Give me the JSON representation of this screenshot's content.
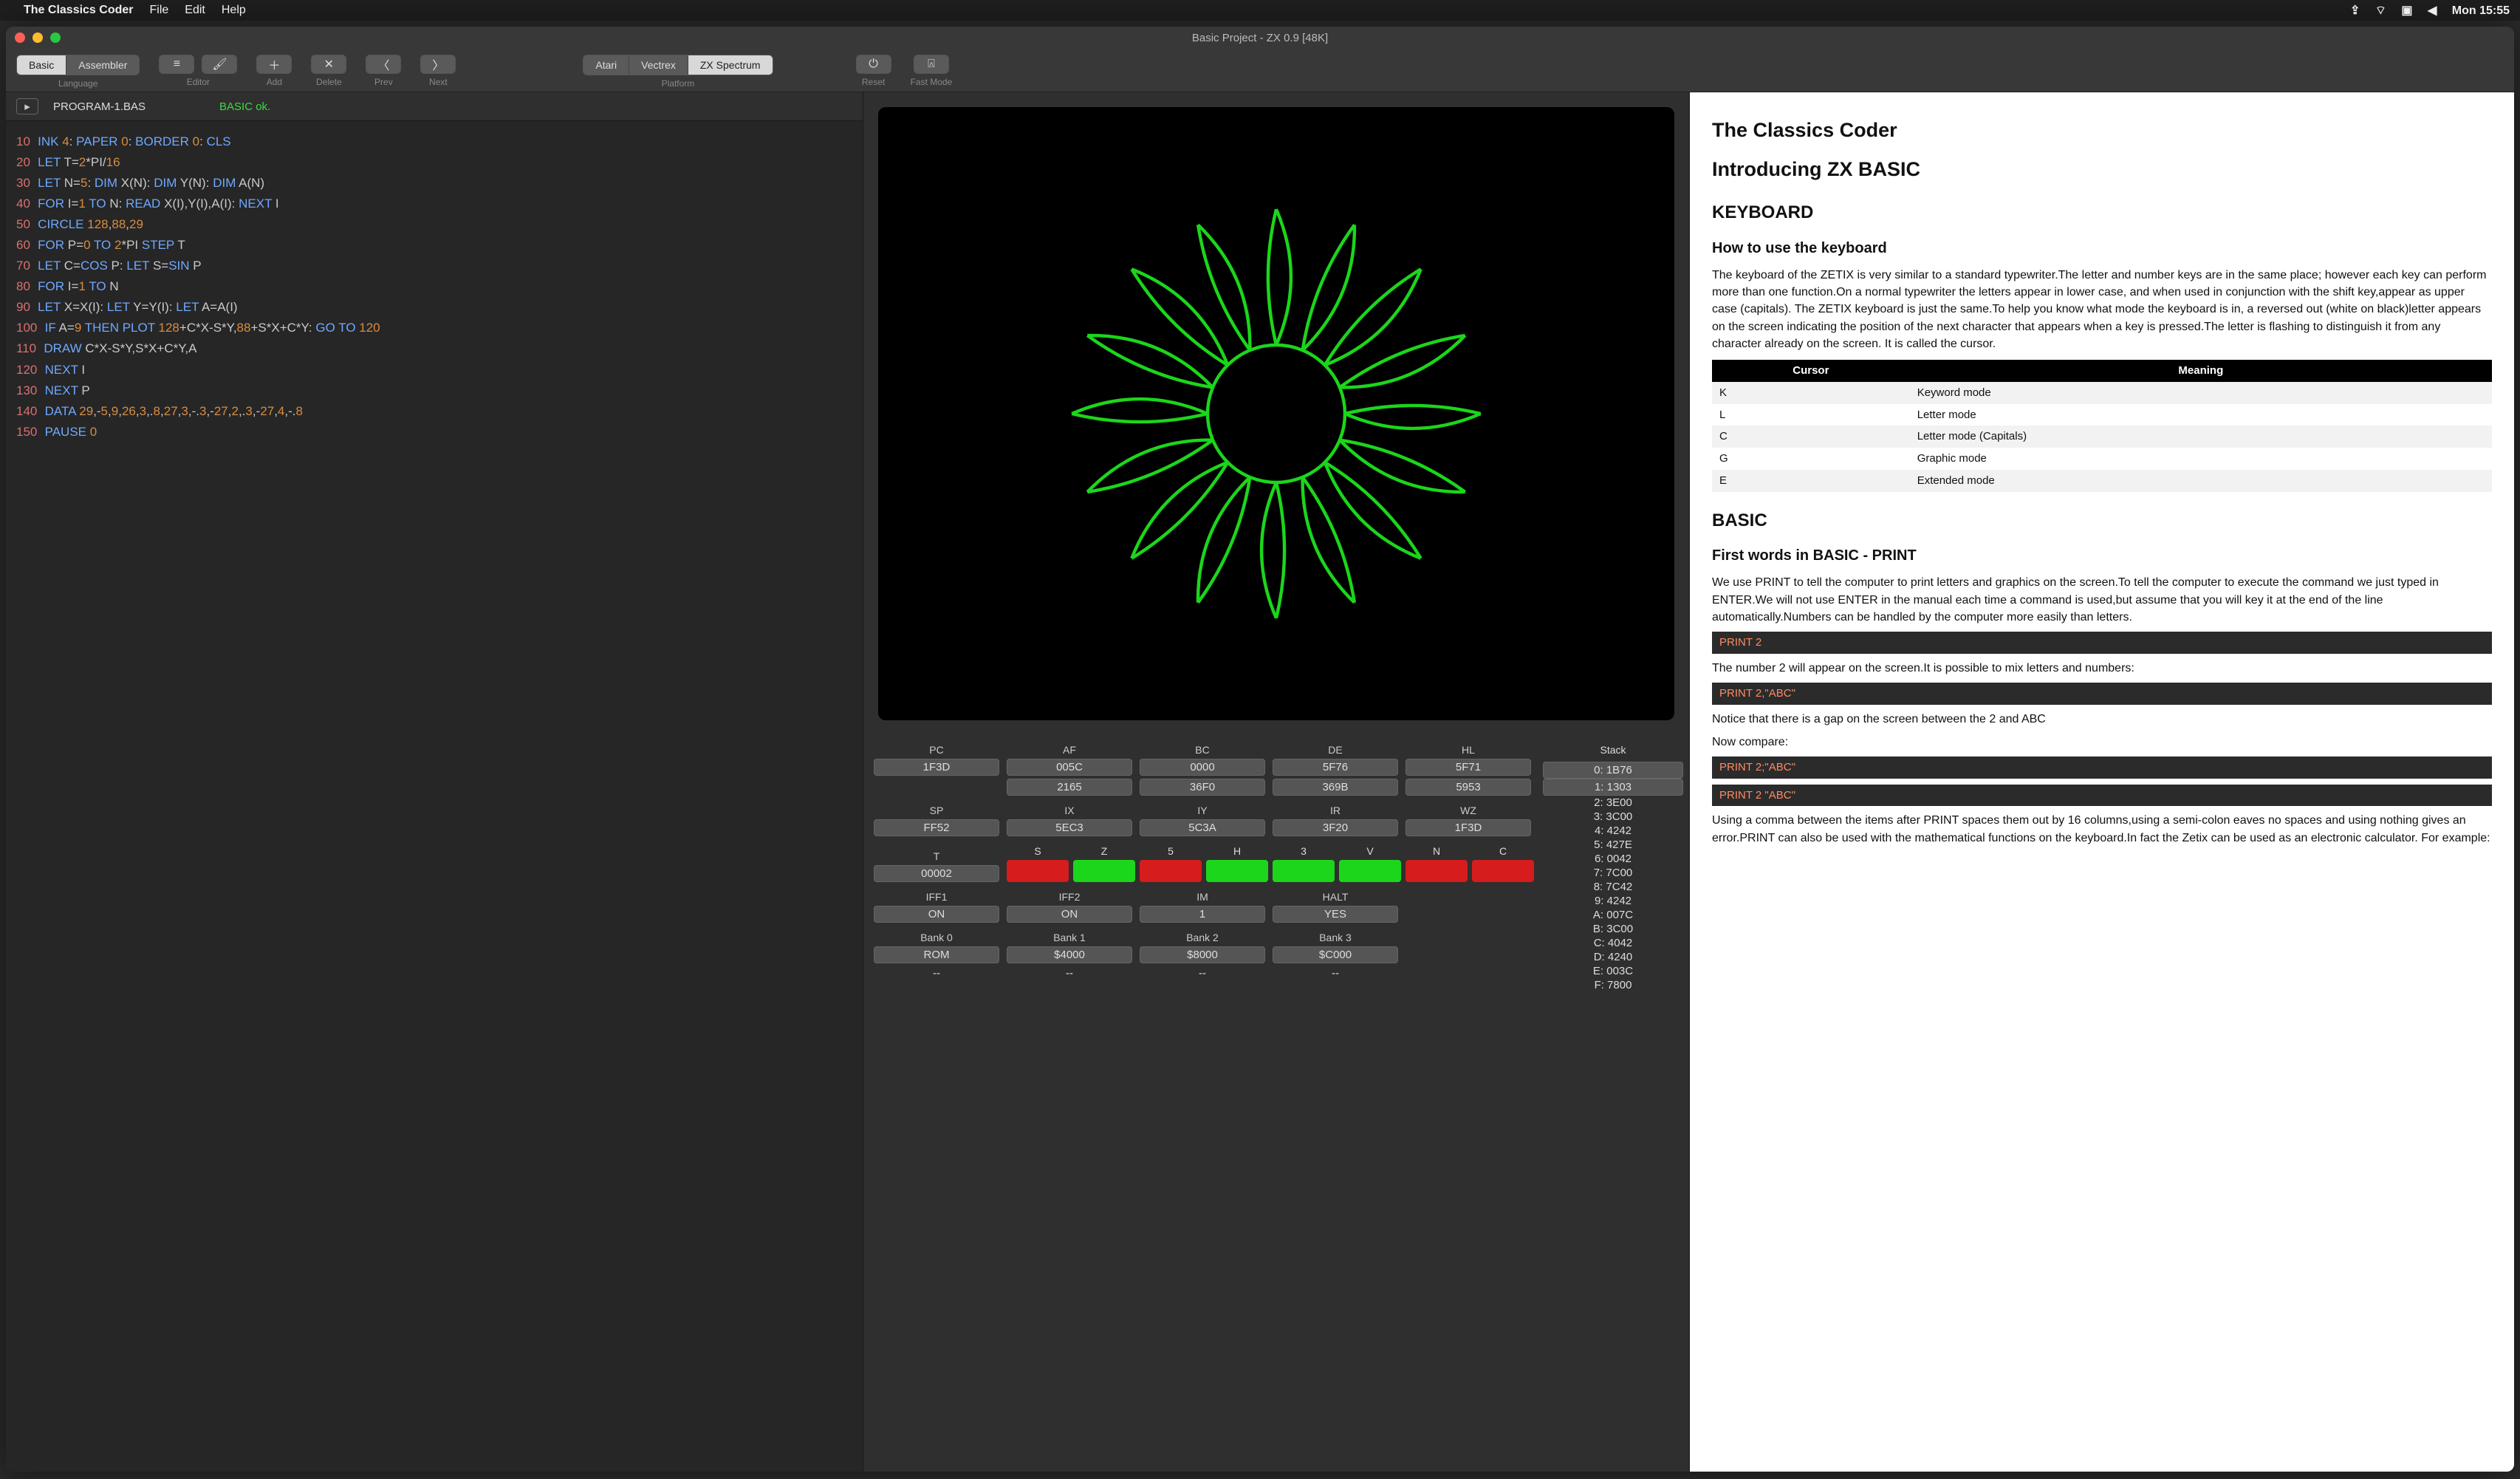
{
  "menubar": {
    "app": "The Classics Coder",
    "items": [
      "File",
      "Edit",
      "Help"
    ],
    "clock": "Mon 15:55"
  },
  "window": {
    "title": "Basic Project - ZX 0.9 [48K]"
  },
  "toolbar": {
    "language": {
      "label": "Language",
      "options": [
        "Basic",
        "Assembler"
      ],
      "active": 0
    },
    "editor": {
      "label": "Editor"
    },
    "add": {
      "label": "Add"
    },
    "delete": {
      "label": "Delete"
    },
    "prev": {
      "label": "Prev"
    },
    "next": {
      "label": "Next"
    },
    "platform": {
      "label": "Platform",
      "options": [
        "Atari",
        "Vectrex",
        "ZX Spectrum"
      ],
      "active": 2
    },
    "reset": {
      "label": "Reset"
    },
    "fast": {
      "label": "Fast Mode"
    }
  },
  "file": {
    "name": "PROGRAM-1.BAS",
    "status": "BASIC ok."
  },
  "code": [
    {
      "n": "10",
      "t": [
        [
          "kw",
          "INK "
        ],
        [
          "nm",
          "4"
        ],
        [
          "op",
          ": "
        ],
        [
          "kw",
          "PAPER "
        ],
        [
          "nm",
          "0"
        ],
        [
          "op",
          ": "
        ],
        [
          "kw",
          "BORDER "
        ],
        [
          "nm",
          "0"
        ],
        [
          "op",
          ": "
        ],
        [
          "kw",
          "CLS"
        ]
      ]
    },
    {
      "n": "20",
      "t": [
        [
          "kw",
          "LET "
        ],
        [
          "id",
          "T="
        ],
        [
          "nm",
          "2"
        ],
        [
          "id",
          "*PI/"
        ],
        [
          "nm",
          "16"
        ]
      ]
    },
    {
      "n": "30",
      "t": [
        [
          "kw",
          "LET "
        ],
        [
          "id",
          "N="
        ],
        [
          "nm",
          "5"
        ],
        [
          "op",
          ": "
        ],
        [
          "kw",
          "DIM "
        ],
        [
          "id",
          "X(N)"
        ],
        [
          "op",
          ": "
        ],
        [
          "kw",
          "DIM "
        ],
        [
          "id",
          "Y(N)"
        ],
        [
          "op",
          ": "
        ],
        [
          "kw",
          "DIM "
        ],
        [
          "id",
          "A(N)"
        ]
      ]
    },
    {
      "n": "40",
      "t": [
        [
          "kw",
          "FOR "
        ],
        [
          "id",
          "I="
        ],
        [
          "nm",
          "1"
        ],
        [
          "kw",
          " TO "
        ],
        [
          "id",
          "N"
        ],
        [
          "op",
          ": "
        ],
        [
          "kw",
          "READ "
        ],
        [
          "id",
          "X(I),Y(I),A(I)"
        ],
        [
          "op",
          ": "
        ],
        [
          "kw",
          "NEXT "
        ],
        [
          "id",
          "I"
        ]
      ]
    },
    {
      "n": "50",
      "t": [
        [
          "kw",
          "CIRCLE "
        ],
        [
          "nm",
          "128"
        ],
        [
          "op",
          ","
        ],
        [
          "nm",
          "88"
        ],
        [
          "op",
          ","
        ],
        [
          "nm",
          "29"
        ]
      ]
    },
    {
      "n": "60",
      "t": [
        [
          "kw",
          "FOR "
        ],
        [
          "id",
          "P="
        ],
        [
          "nm",
          "0"
        ],
        [
          "kw",
          " TO "
        ],
        [
          "nm",
          "2"
        ],
        [
          "id",
          "*PI"
        ],
        [
          "kw",
          " STEP "
        ],
        [
          "id",
          "T"
        ]
      ]
    },
    {
      "n": "70",
      "t": [
        [
          "kw",
          "LET "
        ],
        [
          "id",
          "C="
        ],
        [
          "kw",
          "COS "
        ],
        [
          "id",
          "P"
        ],
        [
          "op",
          ": "
        ],
        [
          "kw",
          "LET "
        ],
        [
          "id",
          "S="
        ],
        [
          "kw",
          "SIN "
        ],
        [
          "id",
          "P"
        ]
      ]
    },
    {
      "n": "80",
      "t": [
        [
          "kw",
          "FOR "
        ],
        [
          "id",
          "I="
        ],
        [
          "nm",
          "1"
        ],
        [
          "kw",
          " TO "
        ],
        [
          "id",
          "N"
        ]
      ]
    },
    {
      "n": "90",
      "t": [
        [
          "kw",
          "LET "
        ],
        [
          "id",
          "X=X(I)"
        ],
        [
          "op",
          ": "
        ],
        [
          "kw",
          "LET "
        ],
        [
          "id",
          "Y=Y(I)"
        ],
        [
          "op",
          ": "
        ],
        [
          "kw",
          "LET "
        ],
        [
          "id",
          "A=A(I)"
        ]
      ]
    },
    {
      "n": "100",
      "t": [
        [
          "kw",
          "IF "
        ],
        [
          "id",
          "A="
        ],
        [
          "nm",
          "9"
        ],
        [
          "kw",
          " THEN PLOT "
        ],
        [
          "nm",
          "128"
        ],
        [
          "id",
          "+C*X-S*Y,"
        ],
        [
          "nm",
          "88"
        ],
        [
          "id",
          "+S*X+C*Y"
        ],
        [
          "op",
          ": "
        ],
        [
          "kw",
          "GO TO "
        ],
        [
          "nm",
          "120"
        ]
      ]
    },
    {
      "n": "110",
      "t": [
        [
          "kw",
          "DRAW "
        ],
        [
          "id",
          "C*X-S*Y,S*X+C*Y,A"
        ]
      ]
    },
    {
      "n": "120",
      "t": [
        [
          "kw",
          "NEXT "
        ],
        [
          "id",
          "I"
        ]
      ]
    },
    {
      "n": "130",
      "t": [
        [
          "kw",
          "NEXT "
        ],
        [
          "id",
          "P"
        ]
      ]
    },
    {
      "n": "140",
      "t": [
        [
          "kw",
          "DATA "
        ],
        [
          "nm",
          "29"
        ],
        [
          "op",
          ",-"
        ],
        [
          "nm",
          "5"
        ],
        [
          "op",
          ","
        ],
        [
          "nm",
          "9"
        ],
        [
          "op",
          ","
        ],
        [
          "nm",
          "26"
        ],
        [
          "op",
          ","
        ],
        [
          "nm",
          "3"
        ],
        [
          "op",
          ",."
        ],
        [
          "nm",
          "8"
        ],
        [
          "op",
          ","
        ],
        [
          "nm",
          "27"
        ],
        [
          "op",
          ","
        ],
        [
          "nm",
          "3"
        ],
        [
          "op",
          ",-."
        ],
        [
          "nm",
          "3"
        ],
        [
          "op",
          ",-"
        ],
        [
          "nm",
          "27"
        ],
        [
          "op",
          ","
        ],
        [
          "nm",
          "2"
        ],
        [
          "op",
          ",."
        ],
        [
          "nm",
          "3"
        ],
        [
          "op",
          ",-"
        ],
        [
          "nm",
          "27"
        ],
        [
          "op",
          ","
        ],
        [
          "nm",
          "4"
        ],
        [
          "op",
          ",-."
        ],
        [
          "nm",
          "8"
        ]
      ]
    },
    {
      "n": "150",
      "t": [
        [
          "kw",
          "PAUSE "
        ],
        [
          "nm",
          "0"
        ]
      ]
    }
  ],
  "registers": {
    "row1": [
      {
        "h": "PC",
        "v1": "1F3D",
        "v2": ""
      },
      {
        "h": "AF",
        "v1": "005C",
        "v2": "2165"
      },
      {
        "h": "BC",
        "v1": "0000",
        "v2": "36F0"
      },
      {
        "h": "DE",
        "v1": "5F76",
        "v2": "369B"
      },
      {
        "h": "HL",
        "v1": "5F71",
        "v2": "5953"
      }
    ],
    "row2": [
      {
        "h": "SP",
        "v1": "FF52"
      },
      {
        "h": "IX",
        "v1": "5EC3"
      },
      {
        "h": "IY",
        "v1": "5C3A"
      },
      {
        "h": "IR",
        "v1": "3F20"
      },
      {
        "h": "WZ",
        "v1": "1F3D"
      }
    ],
    "flags": {
      "t": {
        "h": "T",
        "v": "00002"
      },
      "names": [
        "S",
        "Z",
        "5",
        "H",
        "3",
        "V",
        "N",
        "C"
      ],
      "values": [
        0,
        1,
        0,
        1,
        1,
        1,
        0,
        0
      ]
    },
    "row4": [
      {
        "h": "IFF1",
        "v": "ON"
      },
      {
        "h": "IFF2",
        "v": "ON"
      },
      {
        "h": "IM",
        "v": "1"
      },
      {
        "h": "HALT",
        "v": "YES"
      }
    ],
    "banks": [
      {
        "h": "Bank 0",
        "v1": "ROM",
        "v2": "--"
      },
      {
        "h": "Bank 1",
        "v1": "$4000",
        "v2": "--"
      },
      {
        "h": "Bank 2",
        "v1": "$8000",
        "v2": "--"
      },
      {
        "h": "Bank 3",
        "v1": "$C000",
        "v2": "--"
      }
    ]
  },
  "stack": {
    "h": "Stack",
    "rows": [
      "0: 1B76",
      "1: 1303",
      "2: 3E00",
      "3: 3C00",
      "4: 4242",
      "5: 427E",
      "6: 0042",
      "7: 7C00",
      "8: 7C42",
      "9: 4242",
      "A: 007C",
      "B: 3C00",
      "C: 4042",
      "D: 4240",
      "E: 003C",
      "F: 7800"
    ]
  },
  "doc": {
    "t1": "The Classics Coder",
    "t2": "Introducing ZX BASIC",
    "h_kb": "KEYBOARD",
    "h_use": "How to use the keyboard",
    "p_kb": "The keyboard of the ZETIX is very similar to a standard typewriter.The letter and number keys are in the same place; however each key can perform more than one function.On a normal typewriter the letters appear in lower case, and when used in conjunction with the shift key,appear as upper case (capitals). The ZETIX keyboard is just the same.To help you know what mode the keyboard is in, a reversed out (white on black)letter appears on the screen indicating the position of the next character that appears when a key is pressed.The letter is flashing to distinguish it from any character already on the screen. It is called the cursor.",
    "tbl_h1": "Cursor",
    "tbl_h2": "Meaning",
    "tbl": [
      [
        "K",
        "Keyword mode"
      ],
      [
        "L",
        "Letter mode"
      ],
      [
        "C",
        "Letter mode (Capitals)"
      ],
      [
        "G",
        "Graphic mode"
      ],
      [
        "E",
        "Extended mode"
      ]
    ],
    "h_basic": "BASIC",
    "h_first": "First words in BASIC - PRINT",
    "p_first": "We use PRINT to tell the computer to print letters and graphics on the screen.To tell the computer to execute the command we just typed in ENTER.We will not use ENTER in the manual each time a command is used,but assume that you will key it at the end of the line automatically.Numbers can be handled by the computer more easily than letters.",
    "c1": "PRINT 2",
    "p2": "The number 2 will appear on the screen.It is possible to mix letters and numbers:",
    "c2": "PRINT 2,\"ABC\"",
    "p3a": "Notice that there is a gap on the screen between the 2 and ABC",
    "p3b": "Now compare:",
    "c3": "PRINT 2;\"ABC\"",
    "c4": "PRINT 2 \"ABC\"",
    "p4": "Using a comma between the items after PRINT spaces them out by 16 columns,using a semi-colon eaves no spaces and using nothing gives an error.PRINT can also be used with the mathematical functions on the keyboard.In fact the Zetix can be used as an electronic calculator. For example:"
  }
}
